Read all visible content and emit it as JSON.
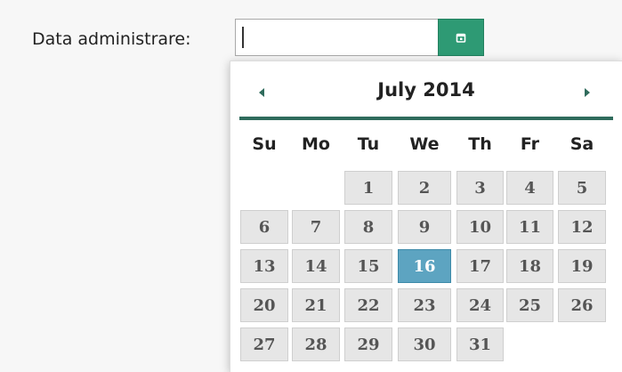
{
  "form": {
    "label": "Data administrare:",
    "input_value": ""
  },
  "icons": {
    "trigger": "calendar-icon",
    "prev": "prev-month-arrow-icon",
    "next": "next-month-arrow-icon"
  },
  "colors": {
    "accent_green": "#2e9a74",
    "header_rule": "#2f6b5c",
    "selected_day": "#5da4c1",
    "day_bg": "#e6e6e6"
  },
  "calendar": {
    "title": "July 2014",
    "weekdays": [
      "Su",
      "Mo",
      "Tu",
      "We",
      "Th",
      "Fr",
      "Sa"
    ],
    "days": [
      "1",
      "2",
      "3",
      "4",
      "5",
      "6",
      "7",
      "8",
      "9",
      "10",
      "11",
      "12",
      "13",
      "14",
      "15",
      "16",
      "17",
      "18",
      "19",
      "20",
      "21",
      "22",
      "23",
      "24",
      "25",
      "26",
      "27",
      "28",
      "29",
      "30",
      "31"
    ],
    "first_weekday_index": 2,
    "selected_day": "16"
  }
}
